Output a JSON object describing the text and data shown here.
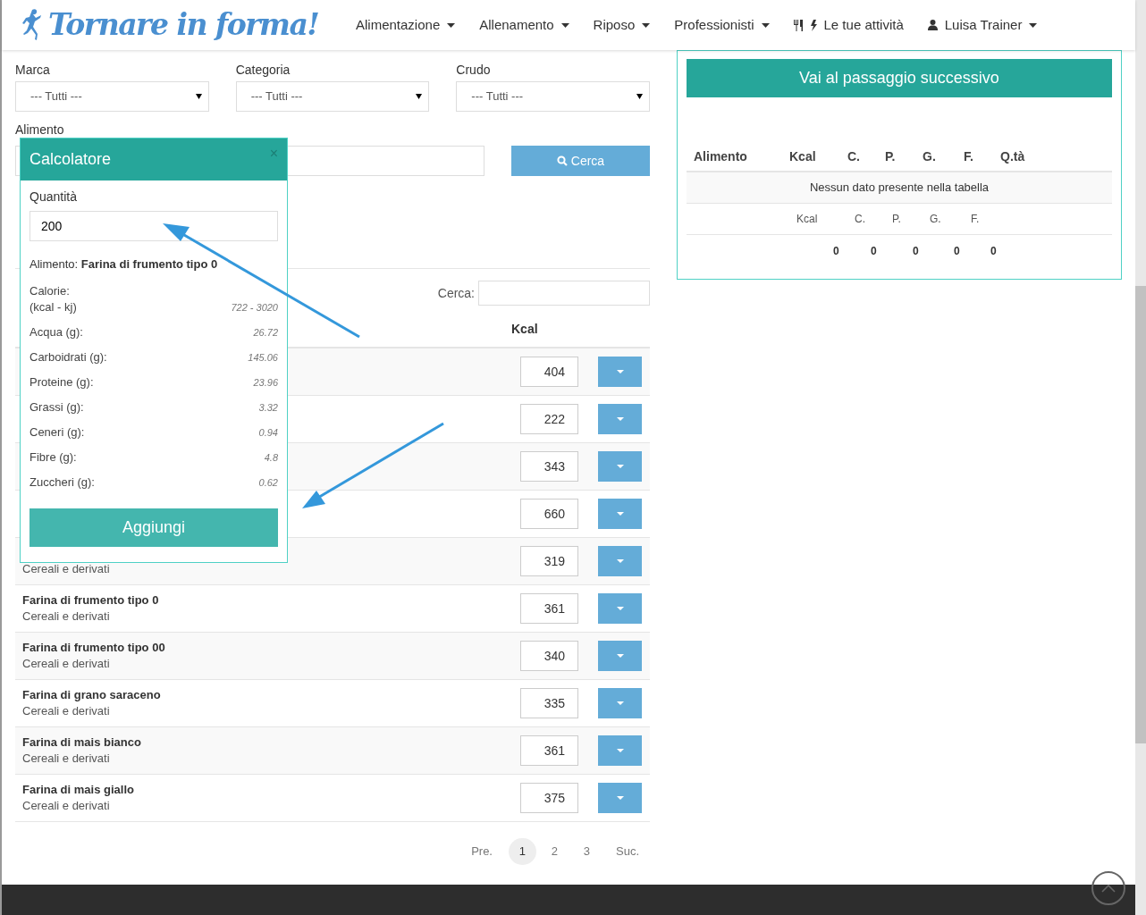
{
  "header": {
    "logo": "Tornare in forma!",
    "nav": [
      {
        "label": "Alimentazione",
        "kind": "dropdown"
      },
      {
        "label": "Allenamento",
        "kind": "dropdown"
      },
      {
        "label": "Riposo",
        "kind": "dropdown"
      },
      {
        "label": "Professionisti",
        "kind": "dropdown"
      },
      {
        "label": "Le tue attività",
        "kind": "activity"
      },
      {
        "label": "Luisa Trainer",
        "kind": "user"
      }
    ]
  },
  "filters": [
    {
      "label": "Marca",
      "value": "--- Tutti ---"
    },
    {
      "label": "Categoria",
      "value": "--- Tutti ---"
    },
    {
      "label": "Crudo",
      "value": "--- Tutti ---"
    }
  ],
  "food_label": "Alimento",
  "search_button": "Cerca",
  "table_search_label": "Cerca:",
  "kcal_header": "Kcal",
  "rows": [
    {
      "kcal": "404"
    },
    {
      "kcal": "222"
    },
    {
      "kcal": "343"
    },
    {
      "kcal": "660"
    },
    {
      "category": "Cereali e derivati",
      "kcal": "319"
    },
    {
      "name": "Farina di frumento tipo 0",
      "category": "Cereali e derivati",
      "kcal": "361"
    },
    {
      "name": "Farina di frumento tipo 00",
      "category": "Cereali e derivati",
      "kcal": "340"
    },
    {
      "name": "Farina di grano saraceno",
      "category": "Cereali e derivati",
      "kcal": "335"
    },
    {
      "name": "Farina di mais bianco",
      "category": "Cereali e derivati",
      "kcal": "361"
    },
    {
      "name": "Farina di mais giallo",
      "category": "Cereali e derivati",
      "kcal": "375"
    }
  ],
  "pagination": {
    "prev": "Pre.",
    "pages": [
      {
        "label": "1",
        "selected": true
      },
      {
        "label": "2",
        "selected": false
      },
      {
        "label": "3",
        "selected": false
      }
    ],
    "next": "Suc."
  },
  "summary": {
    "button": "Vai al passaggio successivo",
    "columns": [
      "Alimento",
      "Kcal",
      "C.",
      "P.",
      "G.",
      "F.",
      "Q.tà"
    ],
    "empty": "Nessun dato presente nella tabella",
    "totals_labels": [
      "Kcal",
      "C.",
      "P.",
      "G.",
      "F."
    ],
    "totals": [
      "0",
      "0",
      "0",
      "0",
      "0"
    ]
  },
  "calculator": {
    "title": "Calcolatore",
    "close": "×",
    "quantity_label": "Quantità",
    "quantity": "200",
    "food_label": "Alimento:",
    "food": "Farina di frumento tipo 0",
    "nutrients": [
      {
        "label": "Calorie:",
        "sublabel": "(kcal - kj)",
        "value": "722 - 3020"
      },
      {
        "label": "Acqua (g):",
        "value": "26.72"
      },
      {
        "label": "Carboidrati (g):",
        "value": "145.06"
      },
      {
        "label": "Proteine (g):",
        "value": "23.96"
      },
      {
        "label": "Grassi (g):",
        "value": "3.32"
      },
      {
        "label": "Ceneri (g):",
        "value": "0.94"
      },
      {
        "label": "Fibre (g):",
        "value": "4.8"
      },
      {
        "label": "Zuccheri (g):",
        "value": "0.62"
      }
    ],
    "button": "Aggiungi"
  }
}
